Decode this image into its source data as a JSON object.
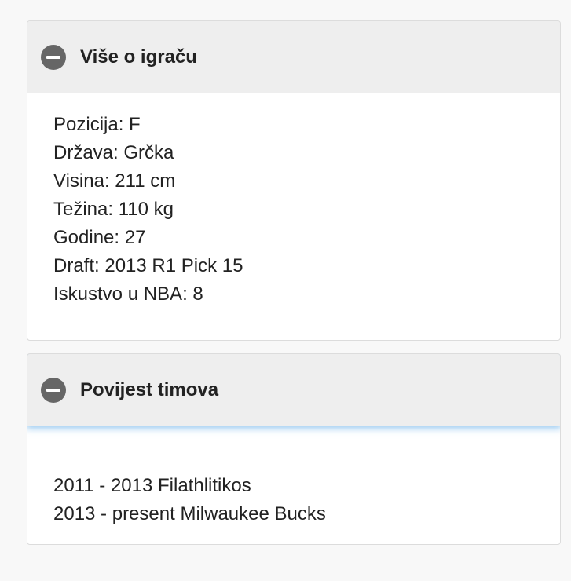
{
  "player_info": {
    "title": "Više o igraču",
    "rows": [
      {
        "label": "Pozicija",
        "value": "F"
      },
      {
        "label": "Država",
        "value": "Grčka"
      },
      {
        "label": "Visina",
        "value": "211 cm"
      },
      {
        "label": "Težina",
        "value": "110 kg"
      },
      {
        "label": "Godine",
        "value": "27"
      },
      {
        "label": "Draft",
        "value": "2013 R1 Pick 15"
      },
      {
        "label": "Iskustvo u NBA",
        "value": "8"
      }
    ]
  },
  "team_history": {
    "title": "Povijest timova",
    "items": [
      {
        "period": "2011 - 2013",
        "team": "Filathlitikos"
      },
      {
        "period": "2013 - present",
        "team": "Milwaukee Bucks"
      }
    ]
  },
  "colors": {
    "icon": "#666666",
    "heading_bg": "#eeeeee",
    "focus_glow": "#66afe9"
  },
  "icons": {
    "collapse": "minus-circle-icon"
  }
}
